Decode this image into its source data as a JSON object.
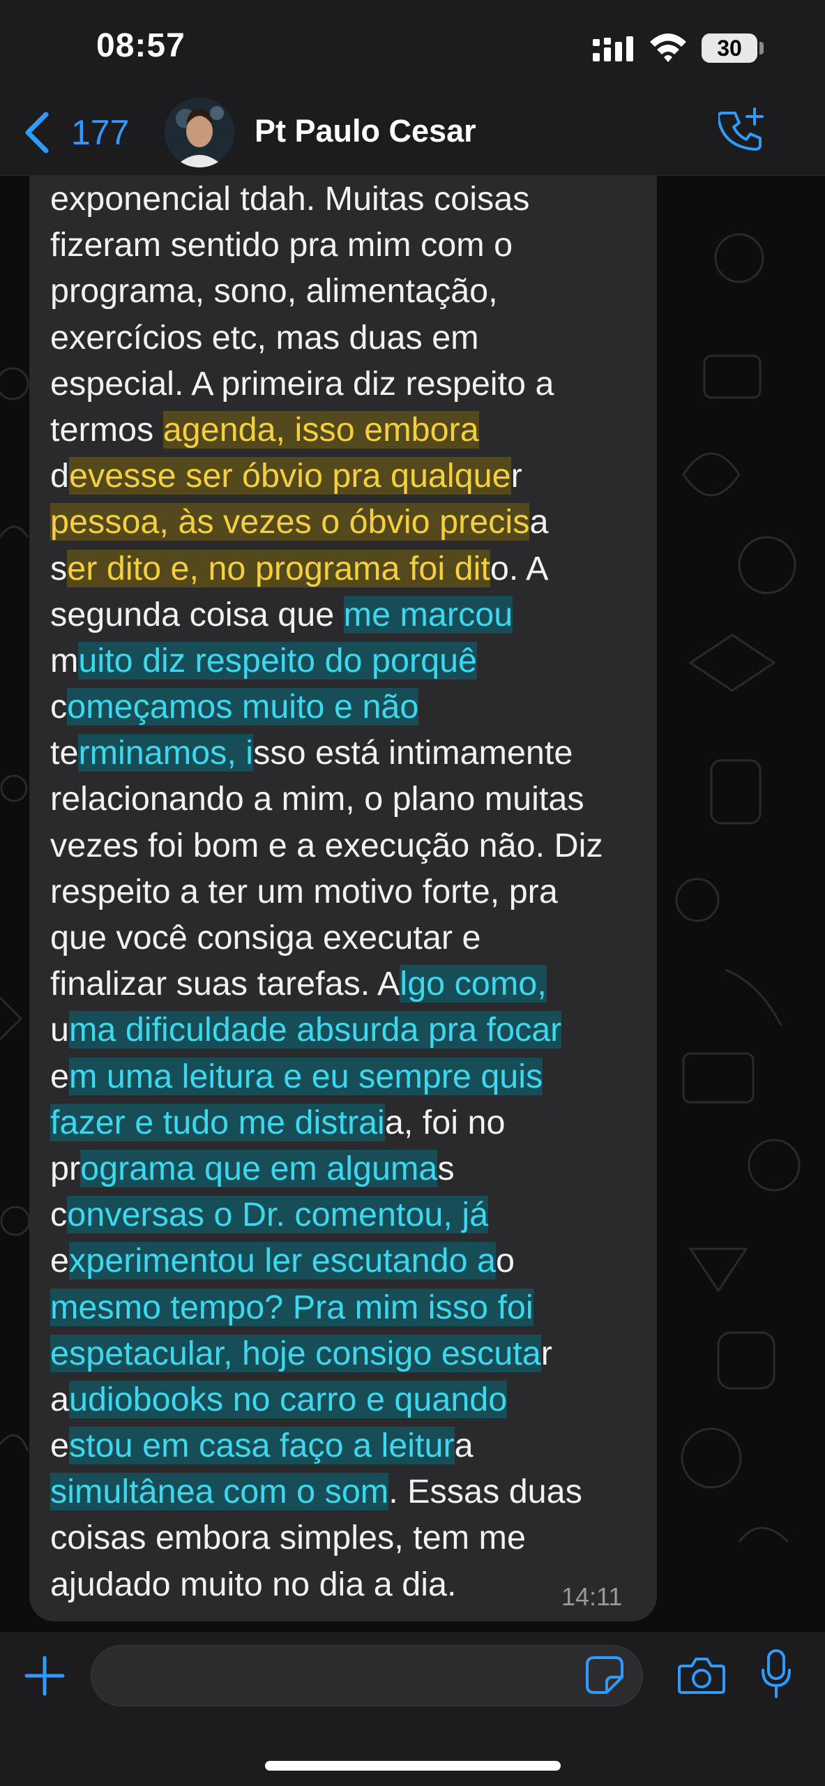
{
  "status_bar": {
    "time": "08:57",
    "battery": "30",
    "icons": [
      "signal-icon",
      "wifi-icon",
      "battery-icon"
    ]
  },
  "header": {
    "back_count": "177",
    "contact_name": "Pt Paulo Cesar",
    "icons": [
      "chevron-left-icon",
      "avatar",
      "phone-plus-icon"
    ],
    "accent_color": "#2f9bff"
  },
  "message": {
    "time": "14:11",
    "highlight_colors": {
      "yellow": "#f4d03f",
      "cyan": "#3ed8ee"
    },
    "lines": [
      [
        {
          "t": "exponencial tdah. Muitas coisas"
        }
      ],
      [
        {
          "t": "fizeram sentido pra mim com o"
        }
      ],
      [
        {
          "t": "programa, sono, alimentação,"
        }
      ],
      [
        {
          "t": "exercícios etc, mas duas em"
        }
      ],
      [
        {
          "t": "especial. A primeira diz respeito a"
        }
      ],
      [
        {
          "t": "termos "
        },
        {
          "t": "agenda, isso embora",
          "h": "y"
        }
      ],
      [
        {
          "t": "d"
        },
        {
          "t": "evesse ser óbvio pra qualque",
          "h": "y"
        },
        {
          "t": "r"
        }
      ],
      [
        {
          "t": "pessoa, às vezes o óbvio precis",
          "h": "y"
        },
        {
          "t": "a"
        }
      ],
      [
        {
          "t": "s"
        },
        {
          "t": "er dito e, no programa foi dit",
          "h": "y"
        },
        {
          "t": "o. A"
        }
      ],
      [
        {
          "t": "segunda coisa que "
        },
        {
          "t": "me marcou",
          "h": "c"
        }
      ],
      [
        {
          "t": "m"
        },
        {
          "t": "uito diz respeito do porquê",
          "h": "c"
        }
      ],
      [
        {
          "t": "c"
        },
        {
          "t": "omeçamos muito e não",
          "h": "c"
        }
      ],
      [
        {
          "t": "te"
        },
        {
          "t": "rminamos, i",
          "h": "c"
        },
        {
          "t": "sso está intimamente"
        }
      ],
      [
        {
          "t": "relacionando a mim, o plano muitas"
        }
      ],
      [
        {
          "t": "vezes foi bom e a execução não. Diz"
        }
      ],
      [
        {
          "t": "respeito a ter um motivo forte, pra"
        }
      ],
      [
        {
          "t": "que você consiga executar e"
        }
      ],
      [
        {
          "t": "finalizar suas tarefas. A"
        },
        {
          "t": "lgo como,",
          "h": "c"
        }
      ],
      [
        {
          "t": "u"
        },
        {
          "t": "ma dificuldade absurda pra focar",
          "h": "c"
        }
      ],
      [
        {
          "t": "e"
        },
        {
          "t": "m uma leitura e eu sempre quis",
          "h": "c"
        }
      ],
      [
        {
          "t": "fazer e tudo me distrai",
          "h": "c"
        },
        {
          "t": "a, foi no"
        }
      ],
      [
        {
          "t": "pr"
        },
        {
          "t": "ograma que em alguma",
          "h": "c"
        },
        {
          "t": "s"
        }
      ],
      [
        {
          "t": "c"
        },
        {
          "t": "onversas o Dr. comentou, já",
          "h": "c"
        }
      ],
      [
        {
          "t": "e"
        },
        {
          "t": "xperimentou ler escutando a",
          "h": "c"
        },
        {
          "t": "o"
        }
      ],
      [
        {
          "t": "mesmo tempo? Pra mim isso foi",
          "h": "c"
        }
      ],
      [
        {
          "t": "espetacular, hoje consigo escuta",
          "h": "c"
        },
        {
          "t": "r"
        }
      ],
      [
        {
          "t": "a"
        },
        {
          "t": "udiobooks no carro e quando",
          "h": "c"
        }
      ],
      [
        {
          "t": "e"
        },
        {
          "t": "stou em casa faço a leitur",
          "h": "c"
        },
        {
          "t": "a"
        }
      ],
      [
        {
          "t": "simultânea com o som",
          "h": "c"
        },
        {
          "t": ". Essas duas"
        }
      ],
      [
        {
          "t": "coisas embora simples, tem me"
        }
      ],
      [
        {
          "t": "ajudado muito no dia a dia."
        }
      ]
    ]
  },
  "composer": {
    "input_value": "",
    "input_placeholder": "",
    "icons": [
      "plus-icon",
      "sticker-icon",
      "camera-icon",
      "microphone-icon"
    ]
  }
}
